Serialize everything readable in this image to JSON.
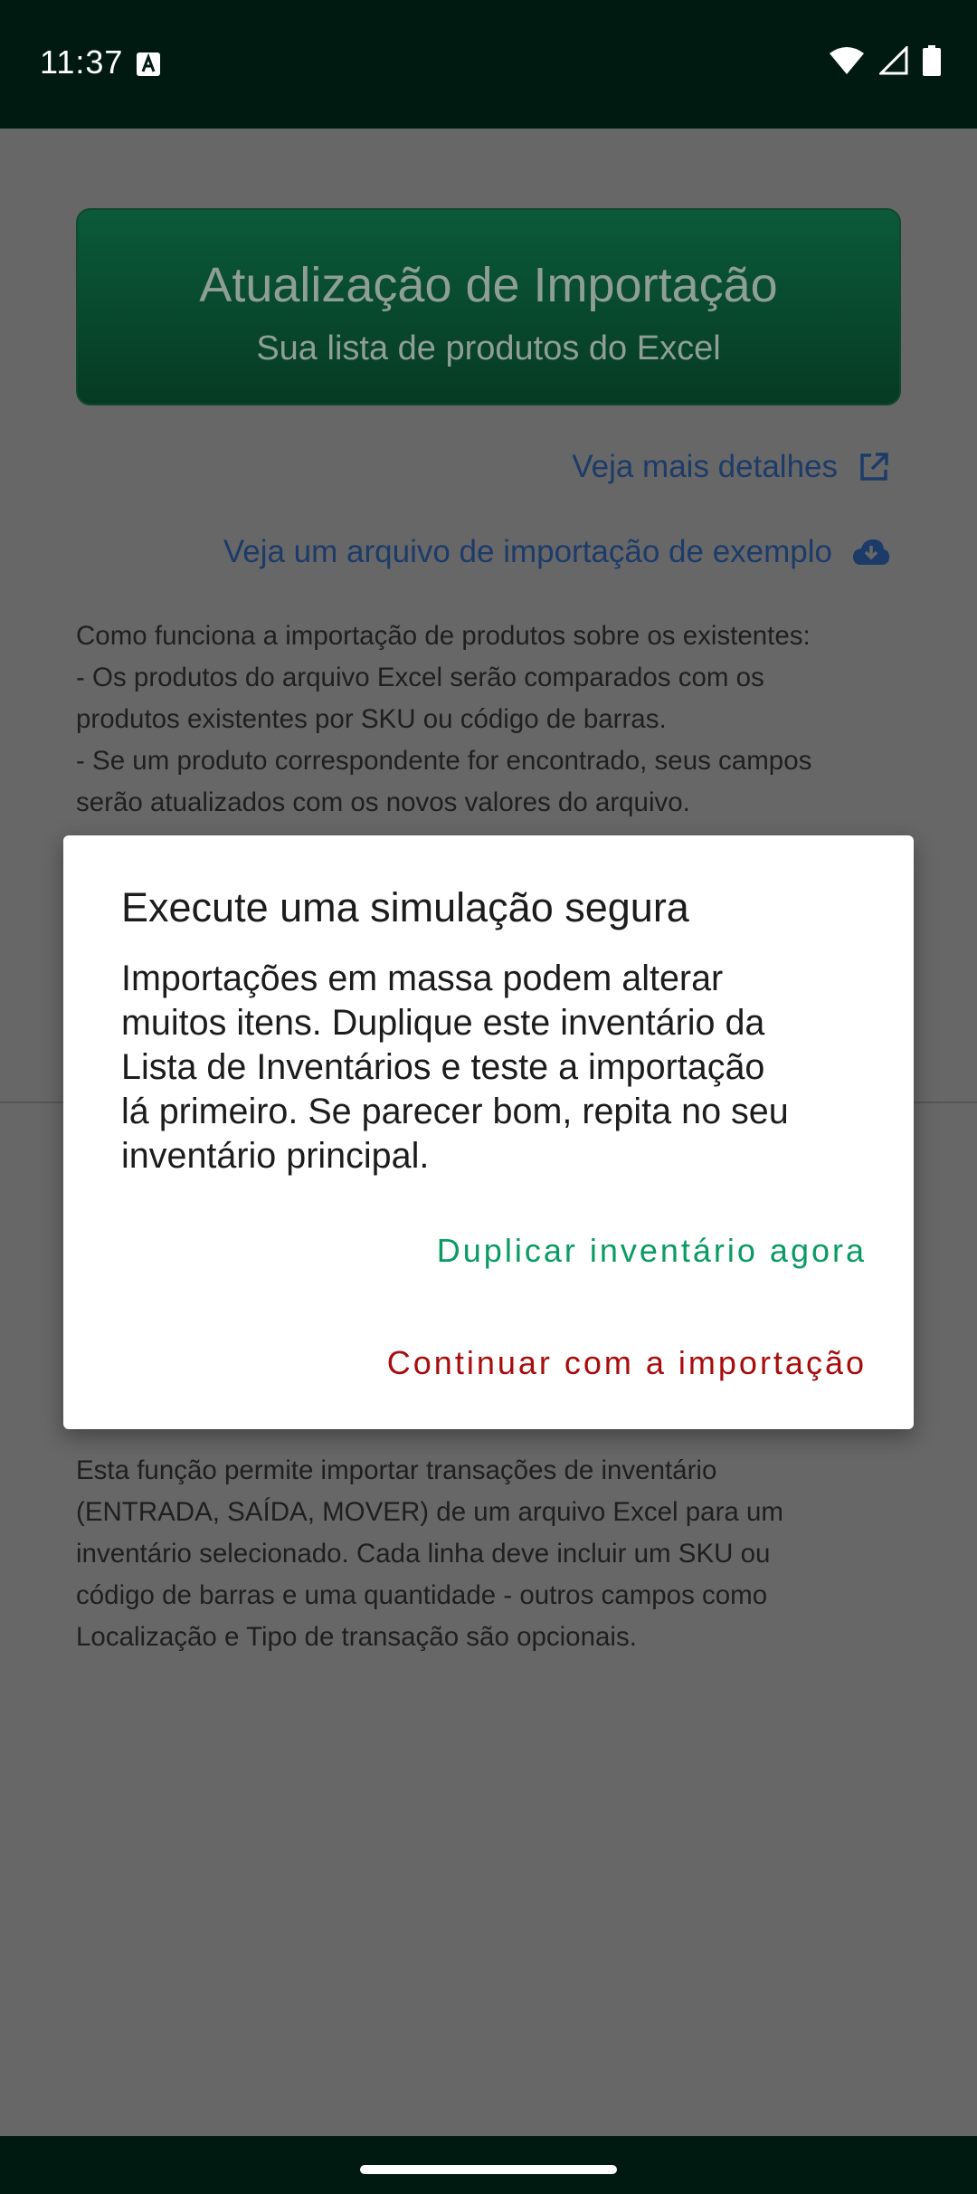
{
  "status_bar": {
    "time": "11:37"
  },
  "header": {
    "title": "Atualização de Importação",
    "subtitle": "Sua lista de produtos do Excel"
  },
  "links": {
    "details": "Veja mais detalhes",
    "sample": "Veja um arquivo de importação de exemplo"
  },
  "description_top": [
    "Como funciona a importação de produtos sobre os existentes:",
    " - Os produtos do arquivo Excel serão comparados com os",
    "produtos existentes por SKU ou código de barras.",
    " - Se um produto correspondente for encontrado, seus campos",
    "serão atualizados com os novos valores do arquivo."
  ],
  "description_bottom": [
    "Esta função permite importar transações de inventário",
    "(ENTRADA, SAÍDA, MOVER) de um arquivo Excel para um",
    "inventário selecionado. Cada linha deve incluir um SKU ou",
    "código de barras e uma quantidade - outros campos como",
    "Localização e Tipo de transação são opcionais."
  ],
  "dialog": {
    "title": "Execute uma simulação segura",
    "body_lines": [
      "Importações em massa podem alterar",
      "muitos itens. Duplique este inventário da",
      "Lista de Inventários e teste a importação",
      "lá primeiro. Se parecer bom, repita no seu",
      "inventário principal."
    ],
    "duplicate_label": "Duplicar inventário agora",
    "continue_label": "Continuar com a importação"
  },
  "colors": {
    "status_bar": "#001a12",
    "dim_overlay": "#676767",
    "banner": "#063a23",
    "positive_action": "#0a9b63",
    "warning_action": "#a80c0c"
  },
  "icons": [
    "text-input-icon",
    "wifi-icon",
    "signal-icon",
    "battery-icon",
    "external-link-icon",
    "download-icon"
  ]
}
